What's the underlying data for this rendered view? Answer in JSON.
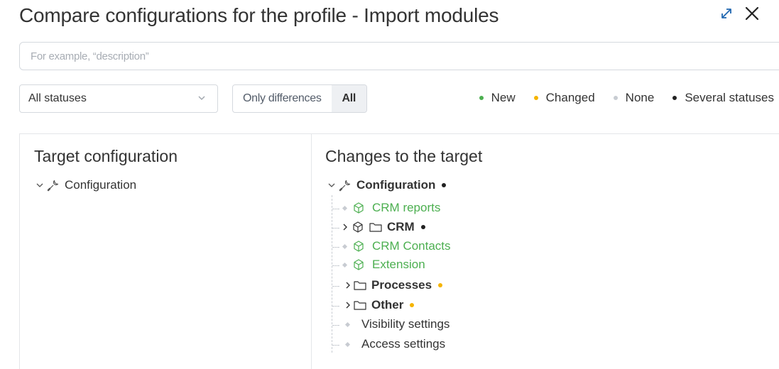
{
  "header": {
    "title": "Compare configurations for the profile - Import modules"
  },
  "search": {
    "placeholder": "For example, “description”",
    "value": ""
  },
  "filters": {
    "status_select": "All statuses",
    "view_toggle": [
      {
        "label": "Only differences",
        "active": false
      },
      {
        "label": "All",
        "active": true
      }
    ]
  },
  "legend": [
    {
      "label": "New",
      "color": "#4caf50"
    },
    {
      "label": "Changed",
      "color": "#f5b400"
    },
    {
      "label": "None",
      "color": "#c8ccd2"
    },
    {
      "label": "Several statuses",
      "color": "#222222"
    }
  ],
  "target_panel": {
    "title": "Target configuration",
    "root": "Configuration"
  },
  "changes_panel": {
    "title": "Changes to the target",
    "root": "Configuration",
    "items": [
      {
        "label": "CRM reports",
        "status": "new",
        "icon": "cube-icon"
      },
      {
        "label": "CRM",
        "status": "several",
        "icon": "folder-icon"
      },
      {
        "label": "CRM Contacts",
        "status": "new",
        "icon": "cube-icon"
      },
      {
        "label": "Extension",
        "status": "new",
        "icon": "cube-icon"
      },
      {
        "label": "Processes",
        "status": "changed",
        "icon": "folder-icon"
      },
      {
        "label": "Other",
        "status": "changed",
        "icon": "folder-icon"
      },
      {
        "label": "Visibility settings",
        "status": "none",
        "icon": ""
      },
      {
        "label": "Access settings",
        "status": "none",
        "icon": ""
      }
    ]
  },
  "colors": {
    "new": "#4caf50",
    "changed": "#f5b400",
    "none": "#c8ccd2",
    "several": "#222222",
    "accent": "#2067b0"
  }
}
